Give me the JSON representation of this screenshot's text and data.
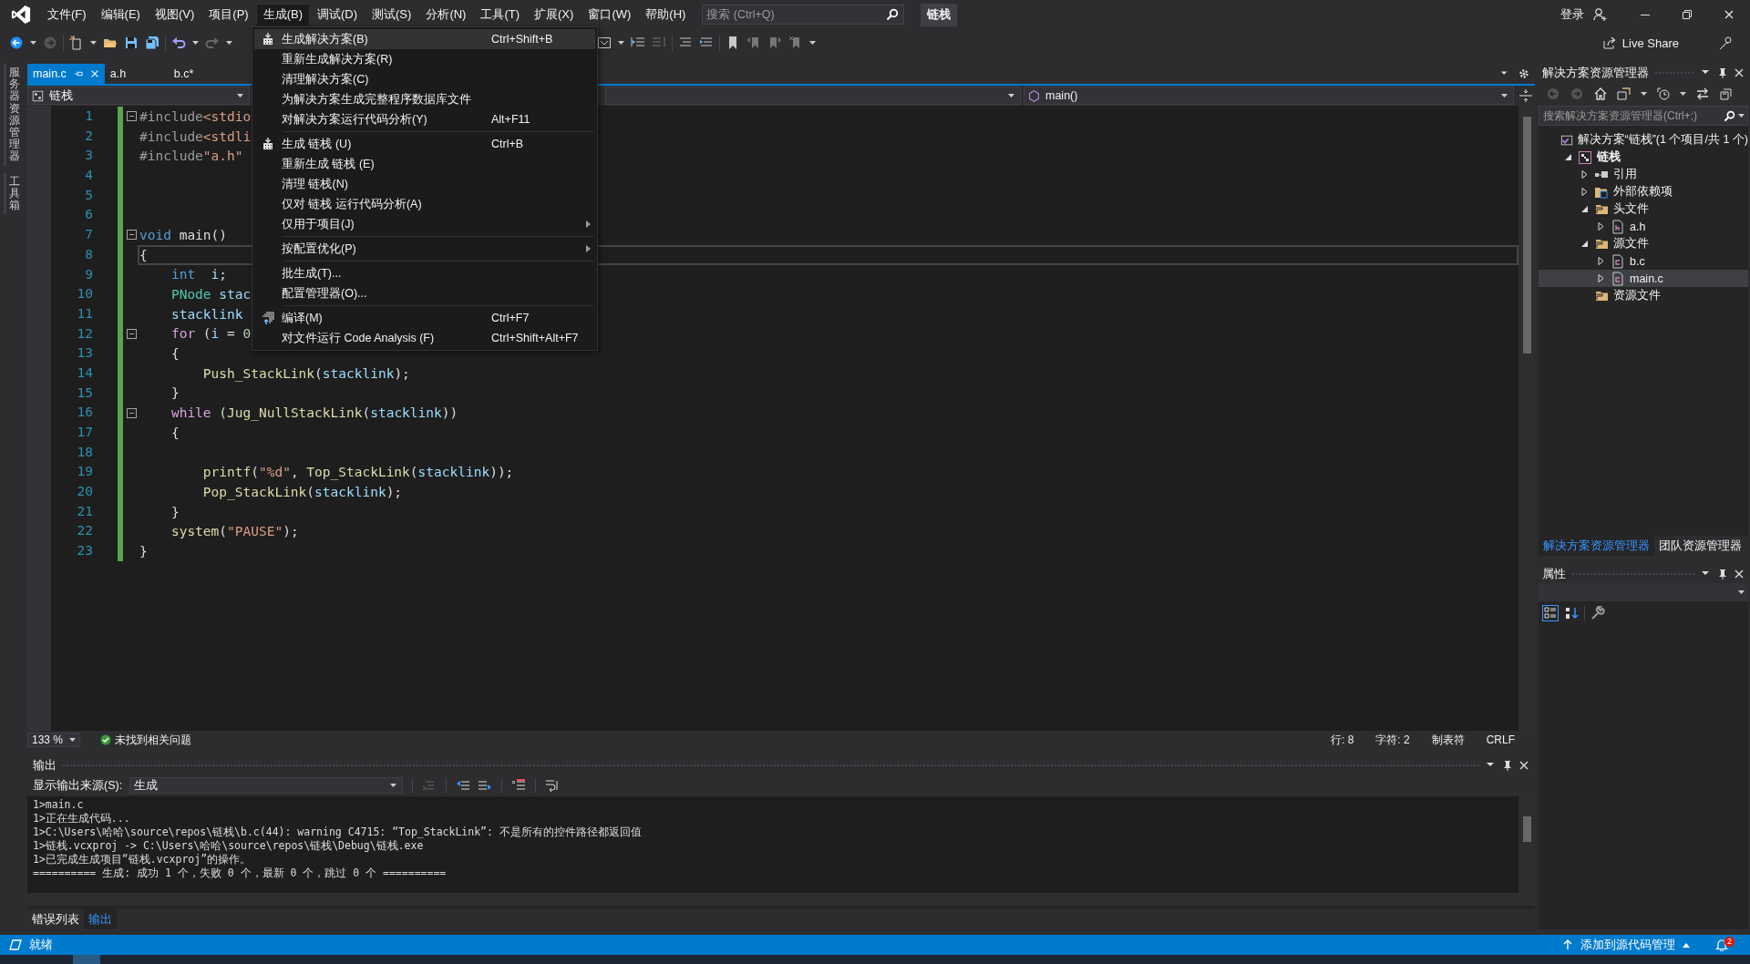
{
  "title_bar": {
    "menus": [
      {
        "label": "文件(F)",
        "selected": false
      },
      {
        "label": "编辑(E)",
        "selected": false
      },
      {
        "label": "视图(V)",
        "selected": false
      },
      {
        "label": "项目(P)",
        "selected": false
      },
      {
        "label": "生成(B)",
        "selected": true
      },
      {
        "label": "调试(D)",
        "selected": false
      },
      {
        "label": "测试(S)",
        "selected": false
      },
      {
        "label": "分析(N)",
        "selected": false
      },
      {
        "label": "工具(T)",
        "selected": false
      },
      {
        "label": "扩展(X)",
        "selected": false
      },
      {
        "label": "窗口(W)",
        "selected": false
      },
      {
        "label": "帮助(H)",
        "selected": false
      }
    ],
    "search": {
      "placeholder": "搜索 (Ctrl+Q)"
    },
    "solution_name": "链栈",
    "sign_in": "登录"
  },
  "toolbar": {
    "live_share": "Live Share"
  },
  "side_strip": {
    "tabs": [
      "服务器资源管理器",
      "工具箱"
    ]
  },
  "build_menu": {
    "items": [
      {
        "kind": "build",
        "label": "生成解决方案(B)",
        "shortcut": "Ctrl+Shift+B",
        "selected": true
      },
      {
        "kind": "item",
        "label": "重新生成解决方案(R)",
        "selected": false
      },
      {
        "kind": "item",
        "label": "清理解决方案(C)",
        "selected": false
      },
      {
        "kind": "item",
        "label": "为解决方案生成完整程序数据库文件",
        "selected": false
      },
      {
        "kind": "item",
        "label": "对解决方案运行代码分析(Y)",
        "shortcut": "Alt+F11",
        "selected": false
      },
      {
        "kind": "separator"
      },
      {
        "kind": "build",
        "label": "生成 链栈 (U)",
        "shortcut": "Ctrl+B",
        "selected": false
      },
      {
        "kind": "item",
        "label": "重新生成 链栈 (E)",
        "selected": false
      },
      {
        "kind": "item",
        "label": "清理 链栈(N)",
        "selected": false
      },
      {
        "kind": "item",
        "label": "仅对 链栈 运行代码分析(A)",
        "selected": false
      },
      {
        "kind": "submenu",
        "label": "仅用于项目(J)",
        "selected": false
      },
      {
        "kind": "separator"
      },
      {
        "kind": "submenu",
        "label": "按配置优化(P)",
        "selected": false
      },
      {
        "kind": "separator"
      },
      {
        "kind": "item",
        "label": "批生成(T)...",
        "selected": false
      },
      {
        "kind": "item",
        "label": "配置管理器(O)...",
        "selected": false
      },
      {
        "kind": "separator"
      },
      {
        "kind": "compile",
        "label": "编译(M)",
        "shortcut": "Ctrl+F7",
        "selected": false
      },
      {
        "kind": "item",
        "label": "对文件运行 Code Analysis (F)",
        "shortcut": "Ctrl+Shift+Alt+F7",
        "selected": false
      }
    ]
  },
  "editor": {
    "tabs": [
      {
        "label": "main.c",
        "selected": true
      },
      {
        "label": "a.h",
        "selected": false
      },
      {
        "label": "b.c*",
        "selected": false
      }
    ],
    "nav": {
      "project": "链栈",
      "member": "main()"
    },
    "lines": [
      {
        "number": "1",
        "fold": true,
        "current": false,
        "tokens": [
          {
            "text": "#include",
            "kind": "pre"
          },
          {
            "text": "<stdio",
            "kind": "str"
          }
        ]
      },
      {
        "number": "2",
        "fold": false,
        "current": false,
        "tokens": [
          {
            "text": "#include",
            "kind": "pre"
          },
          {
            "text": "<stdli",
            "kind": "str"
          }
        ]
      },
      {
        "number": "3",
        "fold": false,
        "current": false,
        "tokens": [
          {
            "text": "#include",
            "kind": "pre"
          },
          {
            "text": "\"a.h\"",
            "kind": "str"
          }
        ]
      },
      {
        "number": "4",
        "fold": false,
        "current": false
      },
      {
        "number": "5",
        "fold": false,
        "current": false
      },
      {
        "number": "6",
        "fold": false,
        "current": false
      },
      {
        "number": "7",
        "fold": true,
        "current": false,
        "tokens": [
          {
            "text": "void",
            "kind": "kw"
          },
          {
            "text": " main()",
            "kind": "plain"
          }
        ]
      },
      {
        "number": "8",
        "fold": false,
        "current": true,
        "tokens": [
          {
            "text": "{",
            "kind": "plain"
          }
        ]
      },
      {
        "number": "9",
        "fold": false,
        "current": false,
        "tokens": [
          {
            "text": "    int",
            "kind": "kw"
          },
          {
            "text": "  i",
            "kind": "var"
          },
          {
            "text": ";",
            "kind": "plain"
          }
        ]
      },
      {
        "number": "10",
        "fold": false,
        "current": false,
        "tokens": [
          {
            "text": "    PNode",
            "kind": "type"
          },
          {
            "text": " stac",
            "kind": "var"
          }
        ]
      },
      {
        "number": "11",
        "fold": false,
        "current": false,
        "tokens": [
          {
            "text": "    stacklink",
            "kind": "var"
          }
        ]
      },
      {
        "number": "12",
        "fold": true,
        "current": false,
        "tokens": [
          {
            "text": "    for",
            "kind": "ctl"
          },
          {
            "text": " (",
            "kind": "plain"
          },
          {
            "text": "i",
            "kind": "var"
          },
          {
            "text": " = ",
            "kind": "plain"
          },
          {
            "text": "0",
            "kind": "num"
          }
        ]
      },
      {
        "number": "13",
        "fold": false,
        "current": false,
        "tokens": [
          {
            "text": "    {",
            "kind": "plain"
          }
        ]
      },
      {
        "number": "14",
        "fold": false,
        "current": false,
        "tokens": [
          {
            "text": "        Push_StackLink",
            "kind": "fn"
          },
          {
            "text": "(",
            "kind": "plain"
          },
          {
            "text": "stacklink",
            "kind": "var"
          },
          {
            "text": ");",
            "kind": "plain"
          }
        ]
      },
      {
        "number": "15",
        "fold": false,
        "current": false,
        "tokens": [
          {
            "text": "    }",
            "kind": "plain"
          }
        ]
      },
      {
        "number": "16",
        "fold": true,
        "current": false,
        "tokens": [
          {
            "text": "    while",
            "kind": "ctl"
          },
          {
            "text": " (",
            "kind": "plain"
          },
          {
            "text": "Jug_NullStackLink",
            "kind": "fn"
          },
          {
            "text": "(",
            "kind": "plain"
          },
          {
            "text": "stacklink",
            "kind": "var"
          },
          {
            "text": "))",
            "kind": "plain"
          }
        ]
      },
      {
        "number": "17",
        "fold": false,
        "current": false,
        "tokens": [
          {
            "text": "    {",
            "kind": "plain"
          }
        ]
      },
      {
        "number": "18",
        "fold": false,
        "current": false
      },
      {
        "number": "19",
        "fold": false,
        "current": false,
        "tokens": [
          {
            "text": "        printf",
            "kind": "fn"
          },
          {
            "text": "(",
            "kind": "plain"
          },
          {
            "text": "\"%d\"",
            "kind": "str"
          },
          {
            "text": ", ",
            "kind": "plain"
          },
          {
            "text": "Top_StackLink",
            "kind": "fn"
          },
          {
            "text": "(",
            "kind": "plain"
          },
          {
            "text": "stacklink",
            "kind": "var"
          },
          {
            "text": "));",
            "kind": "plain"
          }
        ]
      },
      {
        "number": "20",
        "fold": false,
        "current": false,
        "tokens": [
          {
            "text": "        Pop_StackLink",
            "kind": "fn"
          },
          {
            "text": "(",
            "kind": "plain"
          },
          {
            "text": "stacklink",
            "kind": "var"
          },
          {
            "text": ");",
            "kind": "plain"
          }
        ]
      },
      {
        "number": "21",
        "fold": false,
        "current": false,
        "tokens": [
          {
            "text": "    }",
            "kind": "plain"
          }
        ]
      },
      {
        "number": "22",
        "fold": false,
        "current": false,
        "tokens": [
          {
            "text": "    system",
            "kind": "fn"
          },
          {
            "text": "(",
            "kind": "plain"
          },
          {
            "text": "\"PAUSE\"",
            "kind": "str"
          },
          {
            "text": ");",
            "kind": "plain"
          }
        ]
      },
      {
        "number": "23",
        "fold": false,
        "current": false,
        "tokens": [
          {
            "text": "}",
            "kind": "plain"
          }
        ]
      }
    ],
    "zoom": "133 %",
    "issues": "未找到相关问题",
    "line_info": "行: 8",
    "char_info": "字符: 2",
    "indent_mode": "制表符",
    "line_ending": "CRLF"
  },
  "solution_explorer": {
    "title": "解决方案资源管理器",
    "search": {
      "placeholder": "搜索解决方案资源管理器(Ctrl+;)"
    },
    "tree": [
      {
        "label": "解决方案“链栈”(1 个项目/共 1 个)",
        "kind": "solution",
        "selected": false,
        "children": [
          {
            "label": "链栈",
            "kind": "project",
            "expanded": true,
            "selected": false,
            "children": [
              {
                "label": "引用",
                "kind": "references",
                "expanded": false,
                "selected": false
              },
              {
                "label": "外部依赖项",
                "kind": "external",
                "expanded": false,
                "selected": false
              },
              {
                "label": "头文件",
                "kind": "folder",
                "expanded": true,
                "selected": false,
                "children": [
                  {
                    "label": "a.h",
                    "kind": "header",
                    "expanded": false,
                    "selected": false
                  }
                ]
              },
              {
                "label": "源文件",
                "kind": "folder",
                "expanded": true,
                "selected": false,
                "children": [
                  {
                    "label": "b.c",
                    "kind": "source",
                    "expanded": false,
                    "selected": false
                  },
                  {
                    "label": "main.c",
                    "kind": "source",
                    "expanded": false,
                    "selected": true
                  }
                ]
              },
              {
                "label": "资源文件",
                "kind": "folder",
                "selected": false
              }
            ]
          }
        ]
      }
    ],
    "tabs": [
      {
        "label": "解决方案资源管理器",
        "selected": true
      },
      {
        "label": "团队资源管理器",
        "selected": false
      }
    ]
  },
  "properties": {
    "title": "属性"
  },
  "output": {
    "title": "输出",
    "source_label": "显示输出来源(S):",
    "source": "生成",
    "lines": [
      "1>main.c",
      "1>正在生成代码...",
      "1>C:\\Users\\哈哈\\source\\repos\\链栈\\b.c(44): warning C4715: “Top_StackLink”: 不是所有的控件路径都返回值",
      "1>链栈.vcxproj -> C:\\Users\\哈哈\\source\\repos\\链栈\\Debug\\链栈.exe",
      "1>已完成生成项目“链栈.vcxproj”的操作。",
      "========== 生成: 成功 1 个，失败 0 个，最新 0 个，跳过 0 个 =========="
    ],
    "tabs": [
      {
        "label": "错误列表",
        "selected": false
      },
      {
        "label": "输出",
        "selected": true
      }
    ]
  },
  "status_bar": {
    "message": "就绪",
    "source_control": "添加到源代码管理",
    "notifications": "2"
  }
}
